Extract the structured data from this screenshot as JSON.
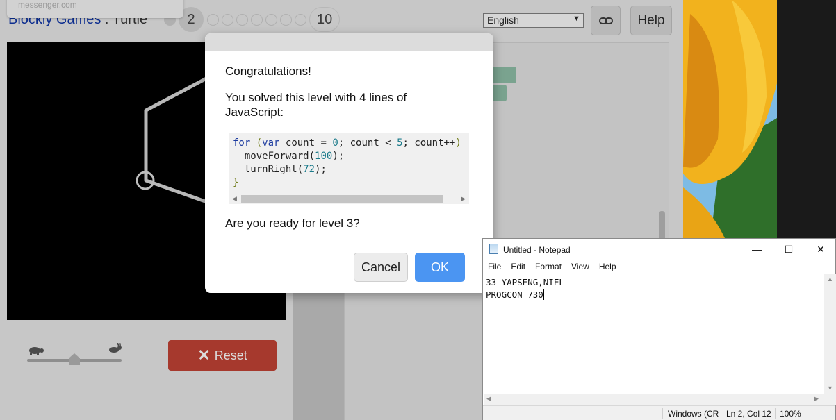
{
  "tooltip": {
    "text": "messenger.com"
  },
  "app": {
    "title_link": "Blockly Games",
    "title_sep": " : ",
    "title_game": "Turtle",
    "current_level": "2",
    "max_level": "10"
  },
  "header": {
    "language": "English",
    "help_label": "Help",
    "link_icon": "link-icon"
  },
  "controls": {
    "reset_label": "Reset",
    "slow_icon": "turtle-icon",
    "fast_icon": "rabbit-icon",
    "speed": 0.5
  },
  "dialog": {
    "title": "Congratulations!",
    "message": "You solved this level with 4 lines of JavaScript:",
    "code_lines": [
      "for (var count = 0; count < 5; count++)",
      "  moveForward(100);",
      "  turnRight(72);",
      "}"
    ],
    "question": "Are you ready for level 3?",
    "cancel_label": "Cancel",
    "ok_label": "OK"
  },
  "notepad": {
    "title": "Untitled - Notepad",
    "menu": [
      "File",
      "Edit",
      "Format",
      "View",
      "Help"
    ],
    "lines": [
      "33_YAPSENG,NIEL",
      "PROGCON 730"
    ],
    "status": {
      "encoding": "Windows (CR",
      "position": "Ln 2, Col 12",
      "zoom": "100%"
    }
  },
  "colors": {
    "reset": "#a6392d",
    "ok": "#4b95f2",
    "link": "#0c2d8f"
  }
}
